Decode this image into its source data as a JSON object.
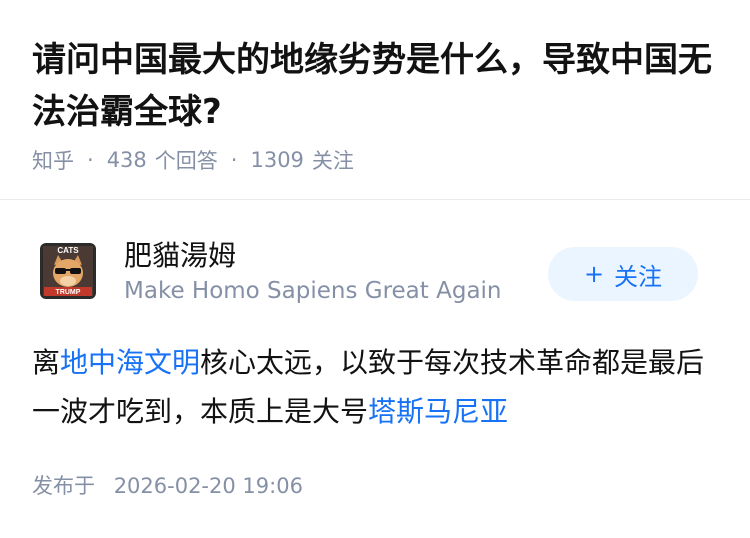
{
  "question": {
    "title": "请问中国最大的地缘劣势是什么，导致中国无法治霸全球?",
    "source": "知乎",
    "answers_count": "438",
    "answers_label": "个回答",
    "followers_count": "1309",
    "followers_label": "关注"
  },
  "author": {
    "avatar_icon": "cat-trump-avatar",
    "avatar_text_top": "CATS",
    "avatar_text_bottom": "TRUMP",
    "name": "肥貓湯姆",
    "bio": "Make Homo Sapiens Great Again",
    "follow_label": "关注",
    "follow_icon": "plus-icon"
  },
  "answer": {
    "segments": [
      {
        "text": "离",
        "link": false
      },
      {
        "text": "地中海文明",
        "link": true
      },
      {
        "text": "核心太远，以致于每次技术革命都是最后一波才吃到，本质上是大号",
        "link": false
      },
      {
        "text": "塔斯马尼亚",
        "link": true
      }
    ],
    "published_label": "发布于",
    "published_time": "2026-02-20 19:06"
  },
  "colors": {
    "link": "#1772f6",
    "meta": "#8590a6",
    "follow_bg": "#ebf5ff"
  }
}
